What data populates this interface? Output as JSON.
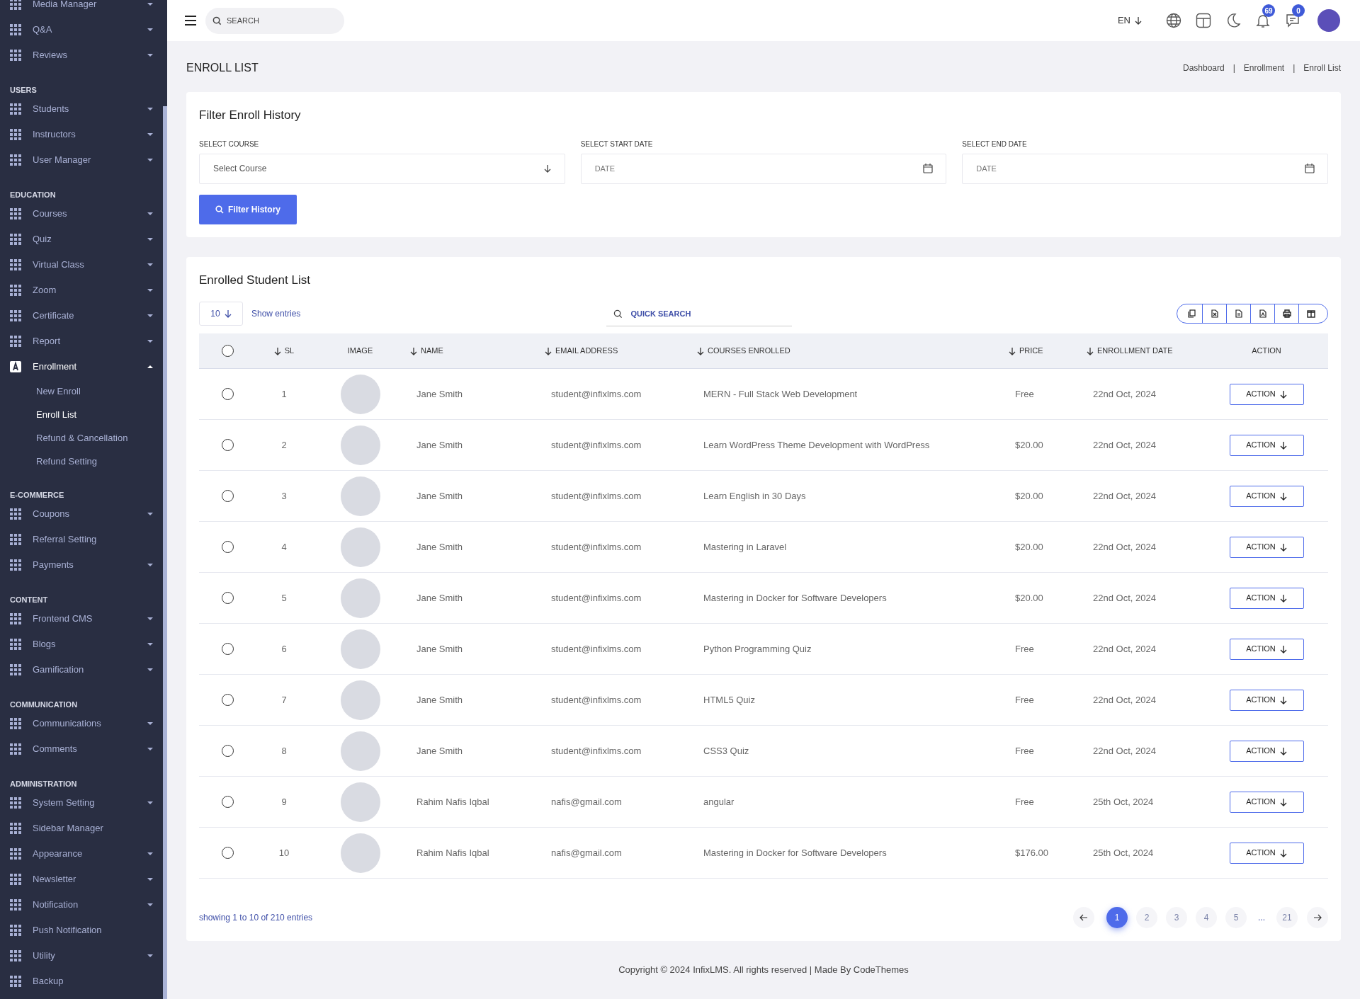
{
  "sidebar": {
    "sections": [
      {
        "items": [
          {
            "label": "Media Manager",
            "caret": true,
            "expanded": false,
            "selected": false
          },
          {
            "label": "Q&A",
            "caret": true,
            "expanded": false,
            "selected": false
          },
          {
            "label": "Reviews",
            "caret": true,
            "expanded": false,
            "selected": false
          }
        ]
      },
      {
        "heading": "USERS",
        "items": [
          {
            "label": "Students",
            "caret": true,
            "expanded": false,
            "selected": false
          },
          {
            "label": "Instructors",
            "caret": true,
            "expanded": false,
            "selected": false
          },
          {
            "label": "User Manager",
            "caret": true,
            "expanded": false,
            "selected": false
          }
        ]
      },
      {
        "heading": "EDUCATION",
        "items": [
          {
            "label": "Courses",
            "caret": true,
            "expanded": false,
            "selected": false
          },
          {
            "label": "Quiz",
            "caret": true,
            "expanded": false,
            "selected": false
          },
          {
            "label": "Virtual Class",
            "caret": true,
            "expanded": false,
            "selected": false
          },
          {
            "label": "Zoom",
            "caret": true,
            "expanded": false,
            "selected": false
          },
          {
            "label": "Certificate",
            "caret": true,
            "expanded": false,
            "selected": false
          },
          {
            "label": "Report",
            "caret": true,
            "expanded": false,
            "selected": false
          },
          {
            "label": "Enrollment",
            "caret": true,
            "expanded": true,
            "selected": true,
            "children": [
              {
                "label": "New Enroll",
                "selected": false
              },
              {
                "label": "Enroll List",
                "selected": true
              },
              {
                "label": "Refund & Cancellation",
                "selected": false
              },
              {
                "label": "Refund Setting",
                "selected": false
              }
            ]
          }
        ]
      },
      {
        "heading": "E-COMMERCE",
        "items": [
          {
            "label": "Coupons",
            "caret": true,
            "expanded": false,
            "selected": false
          },
          {
            "label": "Referral Setting",
            "caret": false,
            "selected": false
          },
          {
            "label": "Payments",
            "caret": true,
            "expanded": false,
            "selected": false
          }
        ]
      },
      {
        "heading": "CONTENT",
        "items": [
          {
            "label": "Frontend CMS",
            "caret": true,
            "expanded": false,
            "selected": false
          },
          {
            "label": "Blogs",
            "caret": true,
            "expanded": false,
            "selected": false
          },
          {
            "label": "Gamification",
            "caret": true,
            "expanded": false,
            "selected": false
          }
        ]
      },
      {
        "heading": "COMMUNICATION",
        "items": [
          {
            "label": "Communications",
            "caret": true,
            "expanded": false,
            "selected": false
          },
          {
            "label": "Comments",
            "caret": true,
            "expanded": false,
            "selected": false
          }
        ]
      },
      {
        "heading": "ADMINISTRATION",
        "items": [
          {
            "label": "System Setting",
            "caret": true,
            "expanded": false,
            "selected": false
          },
          {
            "label": "Sidebar Manager",
            "caret": false,
            "selected": false
          },
          {
            "label": "Appearance",
            "caret": true,
            "expanded": false,
            "selected": false
          },
          {
            "label": "Newsletter",
            "caret": true,
            "expanded": false,
            "selected": false
          },
          {
            "label": "Notification",
            "caret": true,
            "expanded": false,
            "selected": false
          },
          {
            "label": "Push Notification",
            "caret": false,
            "selected": false
          },
          {
            "label": "Utility",
            "caret": true,
            "expanded": false,
            "selected": false
          },
          {
            "label": "Backup",
            "caret": false,
            "selected": false
          }
        ]
      }
    ]
  },
  "header": {
    "search_placeholder": "SEARCH",
    "language": "EN",
    "notification_count": "69",
    "message_count": "0"
  },
  "page_title": "ENROLL LIST",
  "breadcrumb": [
    "Dashboard",
    "|",
    "Enrollment",
    "|",
    "Enroll List"
  ],
  "filter": {
    "title": "Filter Enroll History",
    "fields": [
      {
        "label": "SELECT COURSE",
        "kind": "select",
        "value": "Select Course"
      },
      {
        "label": "SELECT START DATE",
        "kind": "date",
        "placeholder": "DATE"
      },
      {
        "label": "SELECT END DATE",
        "kind": "date",
        "placeholder": "DATE"
      }
    ],
    "button": "Filter History"
  },
  "list": {
    "title": "Enrolled Student List",
    "page_size": "10",
    "show_entries": "Show entries",
    "search_placeholder": "QUICK SEARCH",
    "columns": [
      {
        "label": "SL",
        "sortable": true
      },
      {
        "label": "IMAGE",
        "sortable": false
      },
      {
        "label": "NAME",
        "sortable": true
      },
      {
        "label": "EMAIL ADDRESS",
        "sortable": true
      },
      {
        "label": "COURSES ENROLLED",
        "sortable": true
      },
      {
        "label": "PRICE",
        "sortable": true
      },
      {
        "label": "ENROLLMENT DATE",
        "sortable": true
      },
      {
        "label": "ACTION",
        "sortable": false
      }
    ],
    "header_selected": false,
    "rows": [
      {
        "selected": false,
        "sl": "1",
        "name": "Jane Smith",
        "email": "student@infixlms.com",
        "course": "MERN - Full Stack Web Development",
        "price": "Free",
        "date": "22nd Oct, 2024",
        "action": "ACTION"
      },
      {
        "selected": false,
        "sl": "2",
        "name": "Jane Smith",
        "email": "student@infixlms.com",
        "course": "Learn WordPress Theme Development with WordPress",
        "price": "$20.00",
        "date": "22nd Oct, 2024",
        "action": "ACTION"
      },
      {
        "selected": false,
        "sl": "3",
        "name": "Jane Smith",
        "email": "student@infixlms.com",
        "course": "Learn English in 30 Days",
        "price": "$20.00",
        "date": "22nd Oct, 2024",
        "action": "ACTION"
      },
      {
        "selected": false,
        "sl": "4",
        "name": "Jane Smith",
        "email": "student@infixlms.com",
        "course": "Mastering in Laravel",
        "price": "$20.00",
        "date": "22nd Oct, 2024",
        "action": "ACTION"
      },
      {
        "selected": false,
        "sl": "5",
        "name": "Jane Smith",
        "email": "student@infixlms.com",
        "course": "Mastering in Docker for Software Developers",
        "price": "$20.00",
        "date": "22nd Oct, 2024",
        "action": "ACTION"
      },
      {
        "selected": false,
        "sl": "6",
        "name": "Jane Smith",
        "email": "student@infixlms.com",
        "course": "Python Programming Quiz",
        "price": "Free",
        "date": "22nd Oct, 2024",
        "action": "ACTION"
      },
      {
        "selected": false,
        "sl": "7",
        "name": "Jane Smith",
        "email": "student@infixlms.com",
        "course": "HTML5 Quiz",
        "price": "Free",
        "date": "22nd Oct, 2024",
        "action": "ACTION"
      },
      {
        "selected": false,
        "sl": "8",
        "name": "Jane Smith",
        "email": "student@infixlms.com",
        "course": "CSS3 Quiz",
        "price": "Free",
        "date": "22nd Oct, 2024",
        "action": "ACTION"
      },
      {
        "selected": false,
        "sl": "9",
        "name": "Rahim Nafis Iqbal",
        "email": "nafis@gmail.com",
        "course": "angular",
        "price": "Free",
        "date": "25th Oct, 2024",
        "action": "ACTION"
      },
      {
        "selected": false,
        "sl": "10",
        "name": "Rahim Nafis Iqbal",
        "email": "nafis@gmail.com",
        "course": "Mastering in Docker for Software Developers",
        "price": "$176.00",
        "date": "25th Oct, 2024",
        "action": "ACTION"
      }
    ],
    "summary": "showing 1 to 10 of 210 entries",
    "pages": [
      {
        "label": "1",
        "selected": true
      },
      {
        "label": "2",
        "selected": false
      },
      {
        "label": "3",
        "selected": false
      },
      {
        "label": "4",
        "selected": false
      },
      {
        "label": "5",
        "selected": false
      },
      {
        "label": "...",
        "kind": "ellipsis"
      },
      {
        "label": "21",
        "selected": false
      }
    ]
  },
  "footer": "Copyright © 2024 InfixLMS. All rights reserved | Made By CodeThemes"
}
